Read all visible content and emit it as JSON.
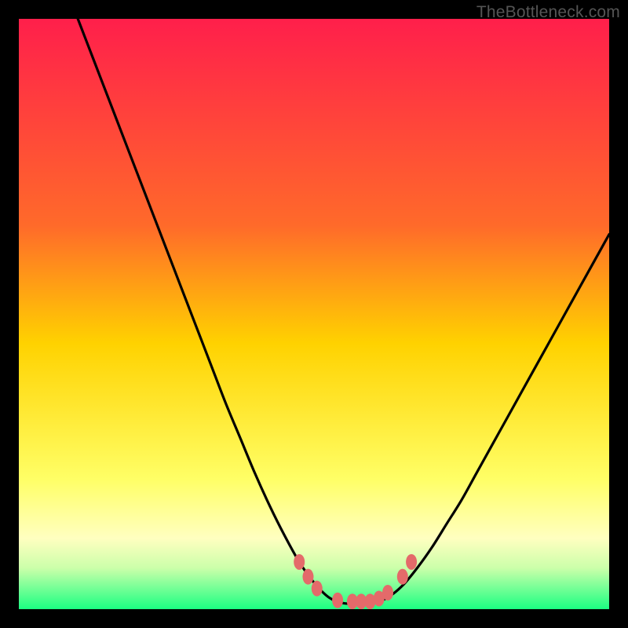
{
  "watermark": "TheBottleneck.com",
  "chart_data": {
    "type": "line",
    "title": "",
    "xlabel": "",
    "ylabel": "",
    "xlim": [
      0,
      100
    ],
    "ylim": [
      0,
      100
    ],
    "grid": false,
    "legend": false,
    "gradient_stops": [
      {
        "offset": 0,
        "color": "#ff1f4b"
      },
      {
        "offset": 35,
        "color": "#ff6a2a"
      },
      {
        "offset": 55,
        "color": "#ffd200"
      },
      {
        "offset": 78,
        "color": "#ffff66"
      },
      {
        "offset": 88,
        "color": "#ffffc0"
      },
      {
        "offset": 93,
        "color": "#ccffaa"
      },
      {
        "offset": 100,
        "color": "#1bff82"
      }
    ],
    "series": [
      {
        "name": "bottleneck-curve",
        "x": [
          10.0,
          12.5,
          15.0,
          17.5,
          20.0,
          22.5,
          25.0,
          27.5,
          30.0,
          32.5,
          35.0,
          37.5,
          40.0,
          42.5,
          45.0,
          47.5,
          50.0,
          52.5,
          55.0,
          57.5,
          60.0,
          62.5,
          65.0,
          67.5,
          70.0,
          72.5,
          75.0,
          77.5,
          80.0,
          82.5,
          85.0,
          87.5,
          90.0,
          92.5,
          95.0,
          97.5,
          100.0
        ],
        "y": [
          100.0,
          93.5,
          87.0,
          80.5,
          74.0,
          67.5,
          61.0,
          54.5,
          48.0,
          41.5,
          35.0,
          29.0,
          23.0,
          17.5,
          12.5,
          8.0,
          4.5,
          2.0,
          1.0,
          1.0,
          1.0,
          2.0,
          4.0,
          7.0,
          10.5,
          14.5,
          18.5,
          23.0,
          27.5,
          32.0,
          36.5,
          41.0,
          45.5,
          50.0,
          54.5,
          59.0,
          63.5
        ]
      }
    ],
    "markers": {
      "name": "curve-nodes",
      "color": "#e46a6a",
      "x": [
        47.5,
        49.0,
        50.5,
        54.0,
        56.5,
        58.0,
        59.5,
        61.0,
        62.5,
        65.0,
        66.5
      ],
      "y": [
        8.0,
        5.5,
        3.5,
        1.5,
        1.3,
        1.3,
        1.3,
        1.8,
        2.8,
        5.5,
        8.0
      ]
    }
  }
}
